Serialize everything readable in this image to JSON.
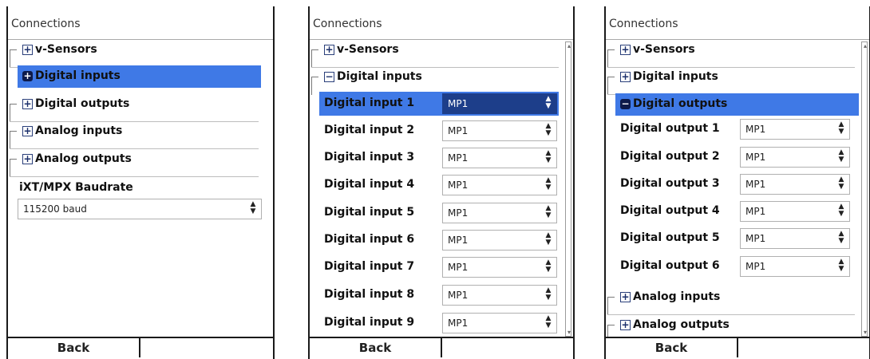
{
  "screens": [
    {
      "title": "Connections",
      "nodes": [
        {
          "label": "v-Sensors",
          "state": "collapsed",
          "selected": false
        },
        {
          "label": "Digital inputs",
          "state": "collapsed",
          "selected": true
        },
        {
          "label": "Digital outputs",
          "state": "collapsed",
          "selected": false
        },
        {
          "label": "Analog inputs",
          "state": "collapsed",
          "selected": false
        },
        {
          "label": "Analog outputs",
          "state": "collapsed",
          "selected": false
        }
      ],
      "baudrate": {
        "label": "iXT/MPX Baudrate",
        "value": "115200 baud"
      },
      "back_label": "Back"
    },
    {
      "title": "Connections",
      "nodes": [
        {
          "label": "v-Sensors",
          "state": "collapsed"
        },
        {
          "label": "Digital inputs",
          "state": "expanded"
        }
      ],
      "rows": [
        {
          "label": "Digital input 1",
          "value": "MP1",
          "active": true
        },
        {
          "label": "Digital input 2",
          "value": "MP1",
          "active": false
        },
        {
          "label": "Digital input 3",
          "value": "MP1",
          "active": false
        },
        {
          "label": "Digital input 4",
          "value": "MP1",
          "active": false
        },
        {
          "label": "Digital input 5",
          "value": "MP1",
          "active": false
        },
        {
          "label": "Digital input 6",
          "value": "MP1",
          "active": false
        },
        {
          "label": "Digital input 7",
          "value": "MP1",
          "active": false
        },
        {
          "label": "Digital input 8",
          "value": "MP1",
          "active": false
        },
        {
          "label": "Digital input 9",
          "value": "MP1",
          "active": false
        }
      ],
      "back_label": "Back"
    },
    {
      "title": "Connections",
      "nodes_top": [
        {
          "label": "v-Sensors",
          "state": "collapsed"
        },
        {
          "label": "Digital inputs",
          "state": "collapsed"
        },
        {
          "label": "Digital outputs",
          "state": "expanded",
          "selected": true
        }
      ],
      "rows": [
        {
          "label": "Digital output 1",
          "value": "MP1"
        },
        {
          "label": "Digital output 2",
          "value": "MP1"
        },
        {
          "label": "Digital output 3",
          "value": "MP1"
        },
        {
          "label": "Digital output 4",
          "value": "MP1"
        },
        {
          "label": "Digital output 5",
          "value": "MP1"
        },
        {
          "label": "Digital output 6",
          "value": "MP1"
        }
      ],
      "nodes_bottom": [
        {
          "label": "Analog inputs",
          "state": "collapsed"
        },
        {
          "label": "Analog outputs",
          "state": "collapsed"
        }
      ],
      "back_label": "Back"
    }
  ],
  "icons": {
    "expand": "plus-icon",
    "collapse": "minus-icon",
    "spinner": "up-down-arrows-icon"
  },
  "colors": {
    "selection": "#3f79e6",
    "active_select": "#1d3e8a"
  }
}
